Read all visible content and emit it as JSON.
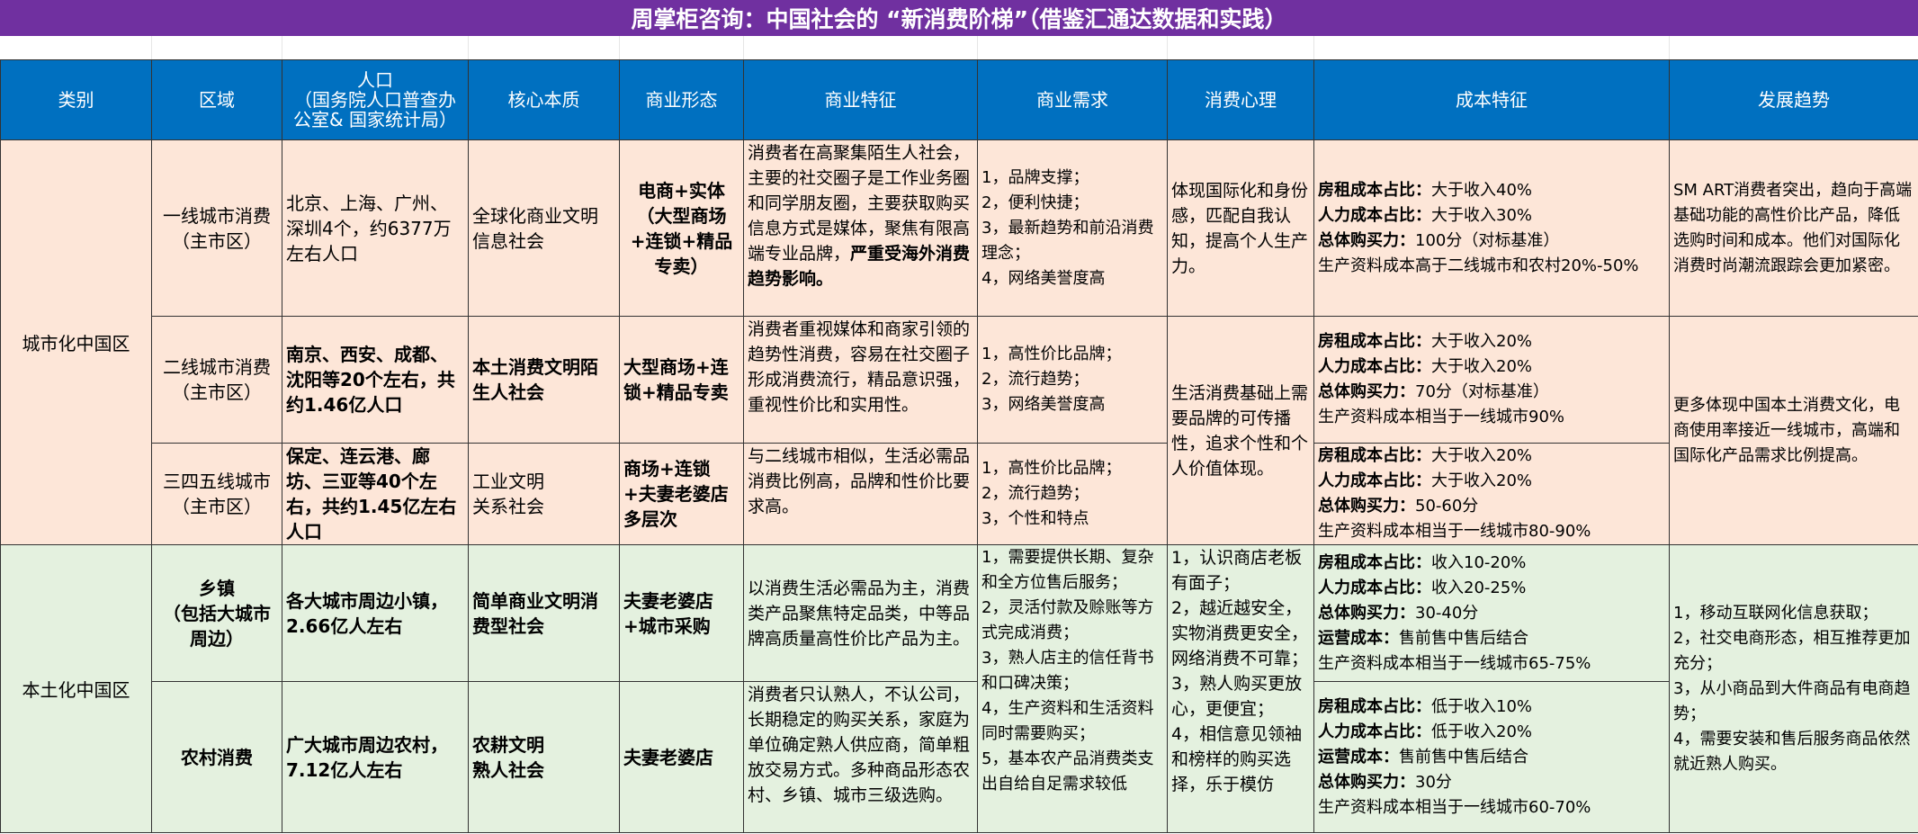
{
  "title": "周掌柜咨询：中国社会的 “新消费阶梯”（借鉴汇通达数据和实践）",
  "headers": [
    "类别",
    "区域",
    "人口\n（国务院人口普查办公室& 国家统计局）",
    "核心本质",
    "商业形态",
    "商业特征",
    "商业需求",
    "消费心理",
    "成本特征",
    "发展趋势"
  ],
  "categories": {
    "urban": "城市化中国区",
    "local": "本土化中国区"
  },
  "rows": [
    {
      "region": "一线城市消费\n（主市区）",
      "population": "北京、上海、广州、深圳4个，约6377万左右人口",
      "core": "全球化商业文明信息社会",
      "form": "电商+实体\n（大型商场+连锁+精品专卖）",
      "feature_pre": "消费者在高聚集陌生人社会，主要的社交圈子是工作业务圈和同学朋友圈，主要获取购买信息方式是媒体，聚焦有限高端专业品牌，",
      "feature_bold": "严重受海外消费趋势影响。",
      "demand": [
        "1，品牌支撑；",
        "2，便利快捷；",
        "3，最新趋势和前沿消费理念；",
        "4，网络美誉度高"
      ],
      "psychology": "体现国际化和身份感，匹配自我认知，提高个人生产力。",
      "cost": [
        {
          "label": "房租成本占比：",
          "value": "大于收入40%"
        },
        {
          "label": "人力成本占比：",
          "value": "大于收入30%"
        },
        {
          "label": "总体购买力：",
          "value": "100分（对标基准）"
        },
        {
          "label": "",
          "value": "生产资料成本高于二线城市和农村20%-50%"
        }
      ],
      "trend": "SM ART消费者突出，趋向于高端基础功能的高性价比产品，降低选购时间和成本。他们对国际化消费时尚潮流跟踪会更加紧密。"
    },
    {
      "region": "二线城市消费\n（主市区）",
      "population": "南京、西安、成都、沈阳等20个左右，共约1.46亿人口",
      "core": "本土消费文明陌生人社会",
      "form": "大型商场+连锁+精品专卖",
      "feature": "消费者重视媒体和商家引领的趋势性消费，容易在社交圈子形成消费流行，精品意识强，重视性价比和实用性。",
      "demand": [
        "1，高性价比品牌；",
        "2，流行趋势；",
        "3，网络美誉度高"
      ],
      "psychology": "生活消费基础上需要品牌的可传播性，追求个性和个人价值体现。",
      "cost": [
        {
          "label": "房租成本占比：",
          "value": "大于收入20%"
        },
        {
          "label": "人力成本占比：",
          "value": "大于收入20%"
        },
        {
          "label": "总体购买力：",
          "value": "70分（对标基准）"
        },
        {
          "label": "",
          "value": "生产资料成本相当于一线城市90%"
        }
      ],
      "trend": "更多体现中国本土消费文化，电商使用率接近一线城市，高端和国际化产品需求比例提高。"
    },
    {
      "region": "三四五线城市\n（主市区）",
      "population": "保定、连云港、廊坊、三亚等40个左右，共约1.45亿左右人口",
      "core": "工业文明\n关系社会",
      "form": "商场+连锁+夫妻老婆店多层次",
      "feature": "与二线城市相似，生活必需品消费比例高，品牌和性价比要求高。",
      "demand": [
        "1，高性价比品牌；",
        "2，流行趋势；",
        "3，个性和特点"
      ],
      "cost": [
        {
          "label": "房租成本占比：",
          "value": "大于收入20%"
        },
        {
          "label": "人力成本占比：",
          "value": "大于收入20%"
        },
        {
          "label": "总体购买力：",
          "value": "50-60分"
        },
        {
          "label": "",
          "value": "生产资料成本相当于一线城市80-90%"
        }
      ]
    },
    {
      "region": "乡镇\n（包括大城市周边）",
      "population": "各大城市周边小镇，2.66亿人左右",
      "core": "简单商业文明消费型社会",
      "form": "夫妻老婆店+城市采购",
      "feature": "以消费生活必需品为主，消费类产品聚焦特定品类，中等品牌高质量高性价比产品为主。",
      "demand": [
        "1，需要提供长期、复杂和全方位售后服务；",
        "2，灵活付款及赊账等方式完成消费；",
        "3，熟人店主的信任背书和口碑决策；",
        "4，生产资料和生活资料同时需要购买；",
        "5，基本农产品消费类支出自给自足需求较低"
      ],
      "psychology": "1，认识商店老板有面子；\n2，越近越安全，实物消费更安全，网络消费不可靠；\n3，熟人购买更放心，更便宜；\n4，相信意见领袖和榜样的购买选择，乐于模仿",
      "cost": [
        {
          "label": "房租成本占比：",
          "value": "收入10-20%"
        },
        {
          "label": "人力成本占比：",
          "value": "收入20-25%"
        },
        {
          "label": "总体购买力：",
          "value": "30-40分"
        },
        {
          "label": "运营成本：",
          "value": "售前售中售后结合"
        },
        {
          "label": "",
          "value": "生产资料成本相当于一线城市65-75%"
        }
      ],
      "trend": "1，移动互联网化信息获取；\n2，社交电商形态，相互推荐更加充分；\n3，从小商品到大件商品有电商趋势；\n4，需要安装和售后服务商品依然就近熟人购买。"
    },
    {
      "region": "农村消费",
      "population": "广大城市周边农村，7.12亿人左右",
      "core": "农耕文明\n熟人社会",
      "form": "夫妻老婆店",
      "feature": "消费者只认熟人，不认公司，长期稳定的购买关系，家庭为单位确定熟人供应商，简单粗放交易方式。多种商品形态农村、乡镇、城市三级选购。",
      "cost": [
        {
          "label": "房租成本占比：",
          "value": "低于收入10%"
        },
        {
          "label": "人力成本占比：",
          "value": "低于收入20%"
        },
        {
          "label": "运营成本：",
          "value": "售前售中售后结合"
        },
        {
          "label": "总体购买力：",
          "value": "30分"
        },
        {
          "label": "",
          "value": "生产资料成本相当于一线城市60-70%"
        }
      ]
    }
  ]
}
